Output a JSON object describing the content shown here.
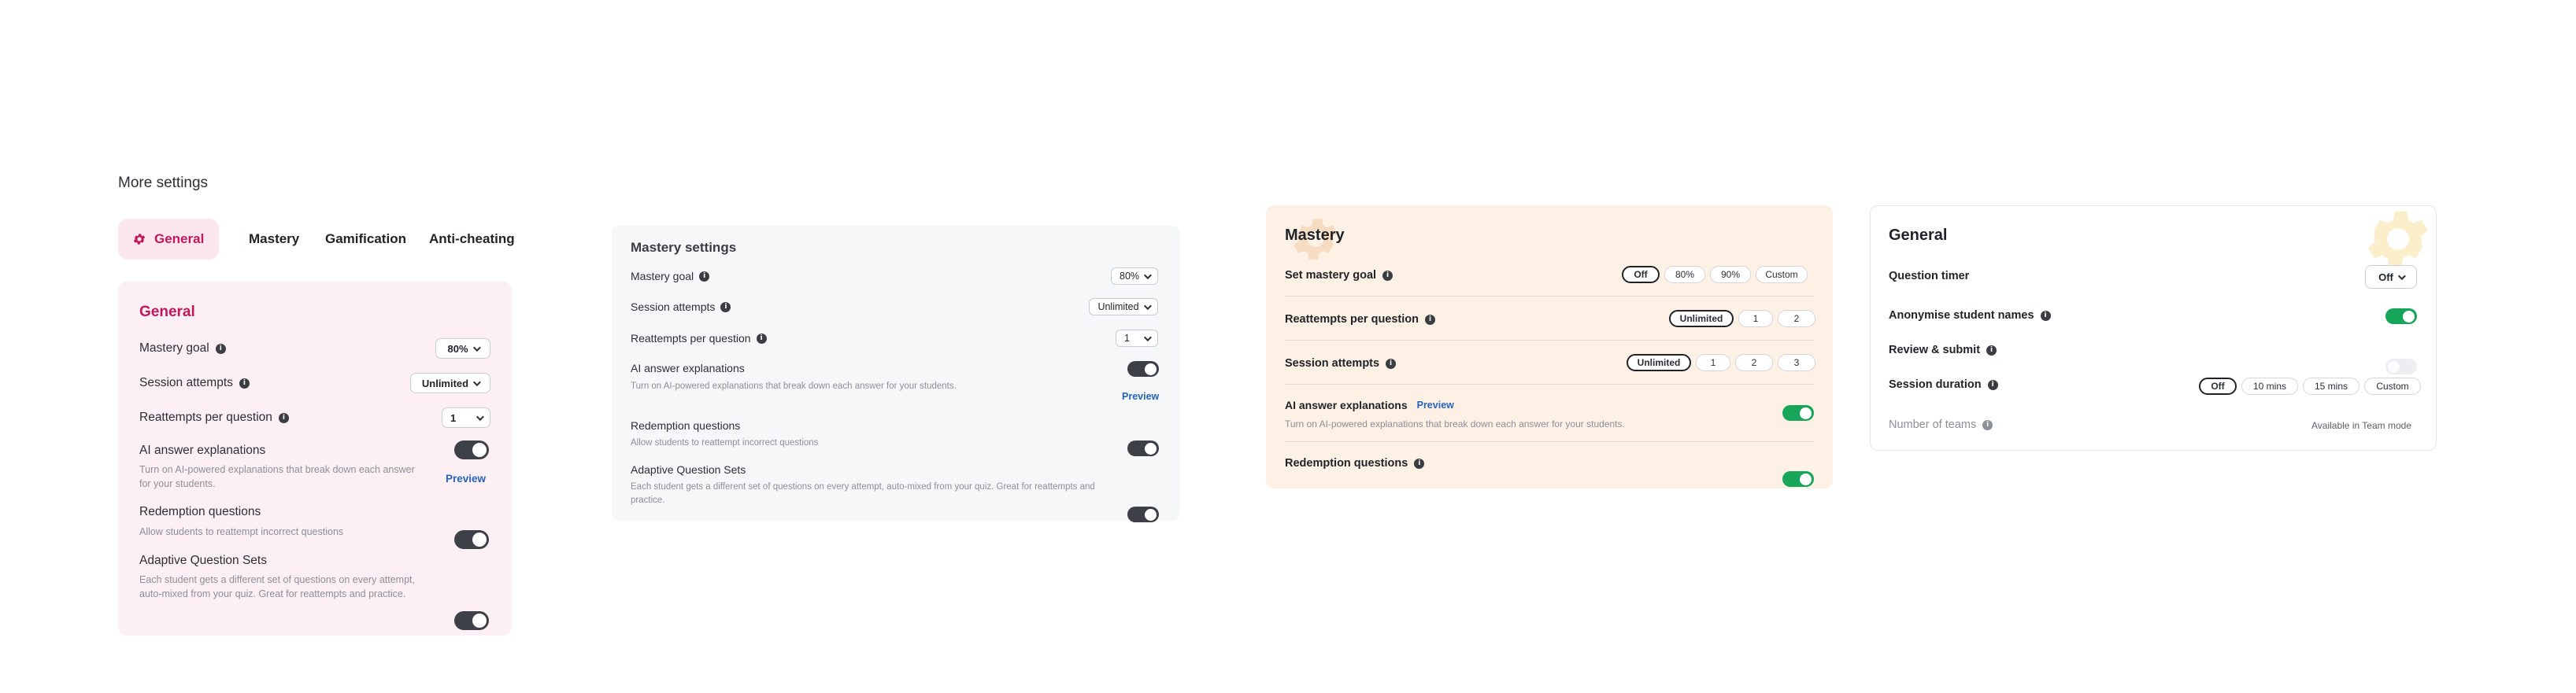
{
  "page": {
    "heading": "More settings"
  },
  "tabs": [
    {
      "label": "General",
      "active": true
    },
    {
      "label": "Mastery"
    },
    {
      "label": "Gamification"
    },
    {
      "label": "Anti-cheating"
    }
  ],
  "card1": {
    "title": "General",
    "mastery_goal": {
      "label": "Mastery goal",
      "value": "80%"
    },
    "session_attempts": {
      "label": "Session attempts",
      "value": "Unlimited"
    },
    "reattempts": {
      "label": "Reattempts per question",
      "value": "1"
    },
    "ai": {
      "label": "AI answer explanations",
      "desc": "Turn on AI-powered explanations that break down each answer for your students.",
      "link": "Preview"
    },
    "redemption": {
      "label": "Redemption questions",
      "desc": "Allow students to reattempt incorrect questions"
    },
    "adaptive": {
      "label": "Adaptive Question Sets",
      "desc": "Each student gets a different set of questions on every attempt, auto-mixed from your quiz. Great for reattempts and practice."
    }
  },
  "card2": {
    "title": "Mastery settings",
    "mastery_goal": {
      "label": "Mastery goal",
      "value": "80%"
    },
    "session_attempts": {
      "label": "Session attempts",
      "value": "Unlimited"
    },
    "reattempts": {
      "label": "Reattempts per question",
      "value": "1"
    },
    "ai": {
      "label": "AI answer explanations",
      "desc": "Turn on AI-powered explanations that break down each answer for your students.",
      "link": "Preview"
    },
    "redemption": {
      "label": "Redemption questions",
      "desc": "Allow students to reattempt incorrect questions"
    },
    "adaptive": {
      "label": "Adaptive Question Sets",
      "desc": "Each student gets a different set of questions on every attempt, auto-mixed from your quiz. Great for reattempts and practice."
    }
  },
  "card3": {
    "title": "Mastery",
    "goal": {
      "label": "Set mastery goal",
      "options": [
        "Off",
        "80%",
        "90%",
        "Custom"
      ],
      "selected": "Off"
    },
    "reattempts": {
      "label": "Reattempts per question",
      "options": [
        "Unlimited",
        "1",
        "2"
      ],
      "selected": "Unlimited"
    },
    "session": {
      "label": "Session attempts",
      "options": [
        "Unlimited",
        "1",
        "2",
        "3"
      ],
      "selected": "Unlimited"
    },
    "ai": {
      "label": "AI answer explanations",
      "link": "Preview",
      "desc": "Turn on AI-powered explanations that break down each answer for your students."
    },
    "redemption": {
      "label": "Redemption questions"
    }
  },
  "card4": {
    "title": "General",
    "timer": {
      "label": "Question timer",
      "value": "Off"
    },
    "anonymise": {
      "label": "Anonymise student names"
    },
    "review": {
      "label": "Review & submit"
    },
    "duration": {
      "label": "Session duration",
      "options": [
        "Off",
        "10 mins",
        "15 mins",
        "Custom"
      ],
      "selected": "Off"
    },
    "teams": {
      "label": "Number of teams",
      "note": "Available in Team mode"
    }
  },
  "colors": {
    "accent_pink": "#c2185b",
    "toggle_green": "#17a55a",
    "link_blue": "#2563b8",
    "card1_bg": "#fdf0f4",
    "card2_bg": "#f6f7f9",
    "card3_bg": "#fdf1e5"
  },
  "icons": {
    "tab_general": "gear-icon",
    "info": "info-icon",
    "chevron": "chevron-down-icon",
    "decor": "gear-icon"
  }
}
